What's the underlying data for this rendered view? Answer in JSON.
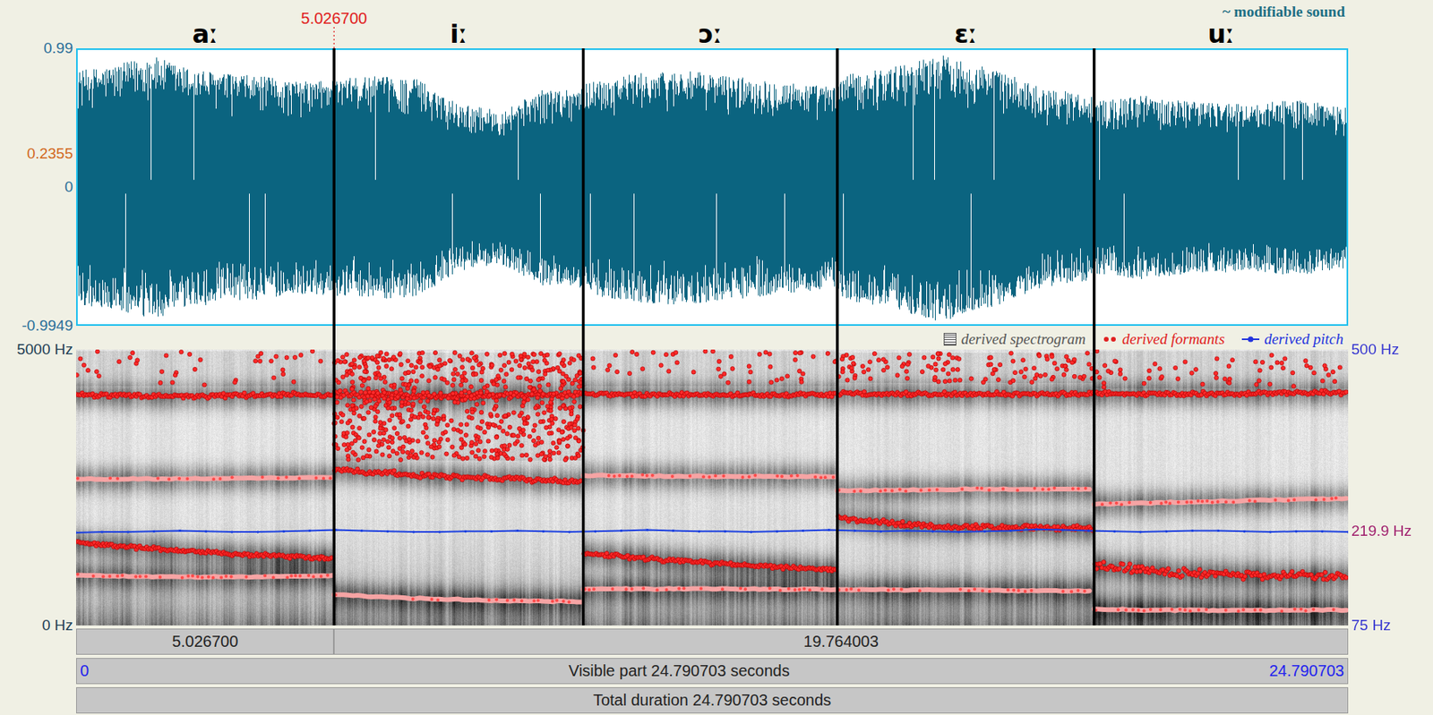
{
  "cursor": {
    "label": "5.026700",
    "time": 5.0267
  },
  "sound": {
    "title": "~ modifiable sound"
  },
  "waveform": {
    "ticks": [
      {
        "label": "0.99",
        "kind": "axis"
      },
      {
        "label": "0.2355",
        "kind": "cursor-value"
      },
      {
        "label": "0",
        "kind": "axis"
      },
      {
        "label": "-0.9949",
        "kind": "axis"
      }
    ]
  },
  "segments": [
    {
      "label": "aː",
      "start": 0,
      "end": 5.0267,
      "envelope": [
        0.84,
        0.88,
        0.95,
        0.86,
        0.82,
        0.8,
        0.76,
        0.78
      ],
      "tracks": [
        {
          "kind": "dots",
          "values": [
            4180,
            4150,
            4170,
            4190
          ],
          "spread": 60
        },
        {
          "kind": "band",
          "values": [
            2650,
            2660,
            2680
          ]
        },
        {
          "kind": "dots",
          "values": [
            1500,
            1380,
            1280,
            1220
          ],
          "spread": 50
        },
        {
          "kind": "band",
          "values": [
            910,
            880,
            880,
            900
          ]
        },
        {
          "kind": "cloud",
          "values": [
            4350,
            4980
          ],
          "count": 40
        }
      ]
    },
    {
      "label": "iː",
      "start": 5.0267,
      "end": 9.884,
      "envelope": [
        0.78,
        0.8,
        0.78,
        0.6,
        0.55,
        0.7,
        0.72
      ],
      "tracks": [
        {
          "kind": "dots",
          "values": [
            4200,
            4150,
            4200
          ],
          "spread": 90
        },
        {
          "kind": "cloud",
          "values": [
            3000,
            4950
          ],
          "count": 700
        },
        {
          "kind": "dots",
          "values": [
            2830,
            2720,
            2660,
            2600
          ],
          "spread": 70
        },
        {
          "kind": "band",
          "values": [
            560,
            490,
            450,
            430
          ]
        }
      ]
    },
    {
      "label": "ɔː",
      "start": 9.884,
      "end": 14.835,
      "envelope": [
        0.76,
        0.82,
        0.84,
        0.8,
        0.76,
        0.72
      ],
      "tracks": [
        {
          "kind": "dots",
          "values": [
            4190,
            4180,
            4180
          ],
          "spread": 55
        },
        {
          "kind": "band",
          "values": [
            2720,
            2700,
            2700
          ]
        },
        {
          "kind": "dots",
          "values": [
            1310,
            1180,
            1080,
            1010
          ],
          "spread": 55
        },
        {
          "kind": "band",
          "values": [
            660,
            660,
            650
          ]
        },
        {
          "kind": "cloud",
          "values": [
            4350,
            4980
          ],
          "count": 50
        }
      ]
    },
    {
      "label": "ɛː",
      "start": 14.835,
      "end": 19.84,
      "envelope": [
        0.8,
        0.86,
        0.96,
        0.86,
        0.72,
        0.66
      ],
      "tracks": [
        {
          "kind": "dots",
          "values": [
            4200,
            4190,
            4200
          ],
          "spread": 55
        },
        {
          "kind": "band",
          "values": [
            2440,
            2470,
            2470
          ]
        },
        {
          "kind": "dots",
          "values": [
            1950,
            1800,
            1780,
            1760
          ],
          "spread": 70
        },
        {
          "kind": "band",
          "values": [
            650,
            640,
            620
          ]
        },
        {
          "kind": "cloud",
          "values": [
            4400,
            4950
          ],
          "count": 120
        }
      ]
    },
    {
      "label": "uː",
      "start": 19.84,
      "end": 24.790703,
      "envelope": [
        0.62,
        0.66,
        0.62,
        0.6,
        0.63,
        0.58
      ],
      "tracks": [
        {
          "kind": "dots",
          "values": [
            4200,
            4200,
            4220
          ],
          "spread": 60
        },
        {
          "kind": "band",
          "values": [
            2200,
            2250,
            2300
          ]
        },
        {
          "kind": "dots",
          "values": [
            1080,
            960,
            900,
            900
          ],
          "spread": 110
        },
        {
          "kind": "band",
          "values": [
            290,
            270,
            280
          ]
        },
        {
          "kind": "cloud",
          "values": [
            4300,
            4980
          ],
          "count": 60
        }
      ]
    }
  ],
  "legend": [
    {
      "label": "derived spectrogram",
      "kind": "spectrogram",
      "color": "#555555"
    },
    {
      "label": "derived formants",
      "kind": "formants",
      "color": "#e02020"
    },
    {
      "label": "derived pitch",
      "kind": "pitch",
      "color": "#2233dd"
    }
  ],
  "spectrogram": {
    "left_ticks": [
      "5000 Hz",
      "0 Hz"
    ],
    "right_ticks": [
      {
        "label": "500 Hz",
        "kind": "axis"
      },
      {
        "label": "219.9 Hz",
        "kind": "cursor-value"
      },
      {
        "label": "75 Hz",
        "kind": "axis"
      }
    ]
  },
  "pitch": {
    "values": [
      218,
      219,
      219,
      220,
      221,
      220,
      219,
      219,
      220,
      221,
      222,
      221,
      220,
      219,
      219,
      220,
      220,
      221,
      220,
      219,
      220,
      221,
      222,
      221,
      220,
      220,
      219,
      220,
      221,
      222,
      221,
      220,
      221,
      220,
      219,
      220,
      221,
      223,
      222,
      221,
      220,
      219,
      220,
      221,
      221,
      220,
      219,
      220,
      220,
      219
    ]
  },
  "time_bars": {
    "selection": [
      "5.026700",
      "19.764003"
    ],
    "visible": {
      "start": "0",
      "label": "Visible part 24.790703 seconds",
      "end": "24.790703"
    },
    "total": "Total duration 24.790703 seconds"
  }
}
